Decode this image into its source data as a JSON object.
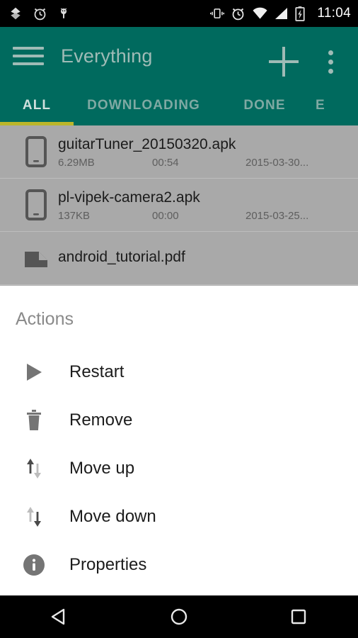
{
  "status_bar": {
    "icons_left": [
      "download-sync-icon",
      "alarm-clock-icon",
      "android-bug-icon"
    ],
    "icons_right": [
      "vibrate-icon",
      "alarm-clock-icon",
      "wifi-icon",
      "cellular-signal-icon",
      "battery-charging-icon"
    ],
    "time": "11:04"
  },
  "appbar": {
    "menu_icon": "hamburger-menu-icon",
    "title": "Everything",
    "add_icon": "plus-icon",
    "overflow_icon": "overflow-menu-icon",
    "background_color": "#006a5e",
    "foreground_color": "#9fbbb6"
  },
  "tabs": {
    "items": [
      {
        "label": "ALL",
        "active": true
      },
      {
        "label": "DOWNLOADING",
        "active": false
      },
      {
        "label": "DONE",
        "active": false
      },
      {
        "label": "E",
        "active": false
      }
    ],
    "indicator_color": "#bcb62b"
  },
  "downloads": {
    "rows": [
      {
        "icon": "phone-apk-icon",
        "name": "guitarTuner_20150320.apk",
        "size": "6.29MB",
        "time": "00:54",
        "date": "2015-03-30..."
      },
      {
        "icon": "phone-apk-icon",
        "name": "pl-vipek-camera2.apk",
        "size": "137KB",
        "time": "00:00",
        "date": "2015-03-25..."
      },
      {
        "icon": "pdf-document-icon",
        "name": "android_tutorial.pdf",
        "size": "",
        "time": "",
        "date": ""
      }
    ]
  },
  "dialog": {
    "title": "Actions",
    "actions": [
      {
        "label": "Restart",
        "icon": "play-triangle-icon"
      },
      {
        "label": "Remove",
        "icon": "trash-can-icon"
      },
      {
        "label": "Move up",
        "icon": "move-up-arrows-icon"
      },
      {
        "label": "Move down",
        "icon": "move-down-arrows-icon"
      },
      {
        "label": "Properties",
        "icon": "info-circle-icon"
      }
    ]
  },
  "navbar": {
    "back": "back-triangle-icon",
    "home": "home-circle-icon",
    "recents": "recents-square-icon"
  }
}
